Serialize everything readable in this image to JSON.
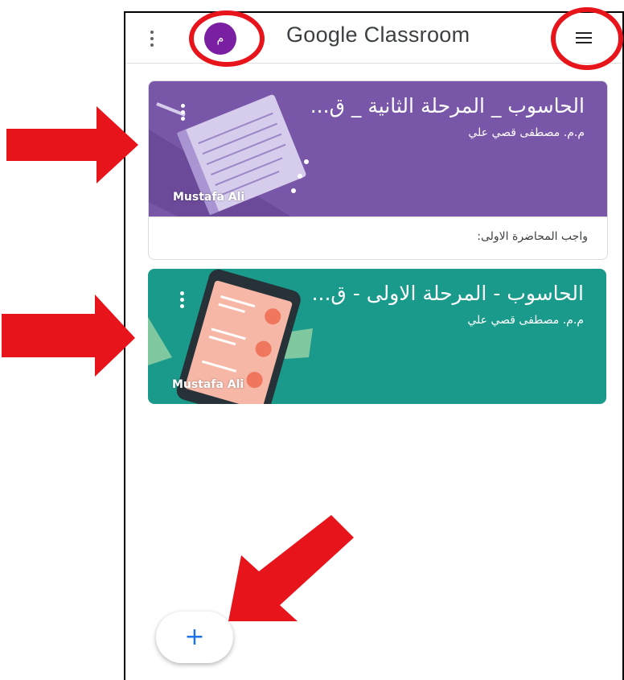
{
  "appbar": {
    "title": "Google Classroom",
    "avatar_letter": "م",
    "kebab_icon": "more-vert-icon",
    "menu_icon": "hamburger-menu-icon"
  },
  "classes": [
    {
      "title": "الحاسوب _ المرحلة الثانية _ ق...",
      "teacher": "م.م. مصطفى قصي علي",
      "owner": "Mustafa Ali",
      "color": "#7957a8",
      "footer": "واجب المحاضرة الاولى:"
    },
    {
      "title": "الحاسوب - المرحلة الاولى - ق...",
      "teacher": "م.م. مصطفى قصي علي",
      "owner": "Mustafa Ali",
      "color": "#1a9a8b"
    }
  ],
  "fab": {
    "label": "+",
    "icon": "plus-icon"
  },
  "colors": {
    "annotation_red": "#e8141b",
    "accent": "#1a73e8"
  }
}
